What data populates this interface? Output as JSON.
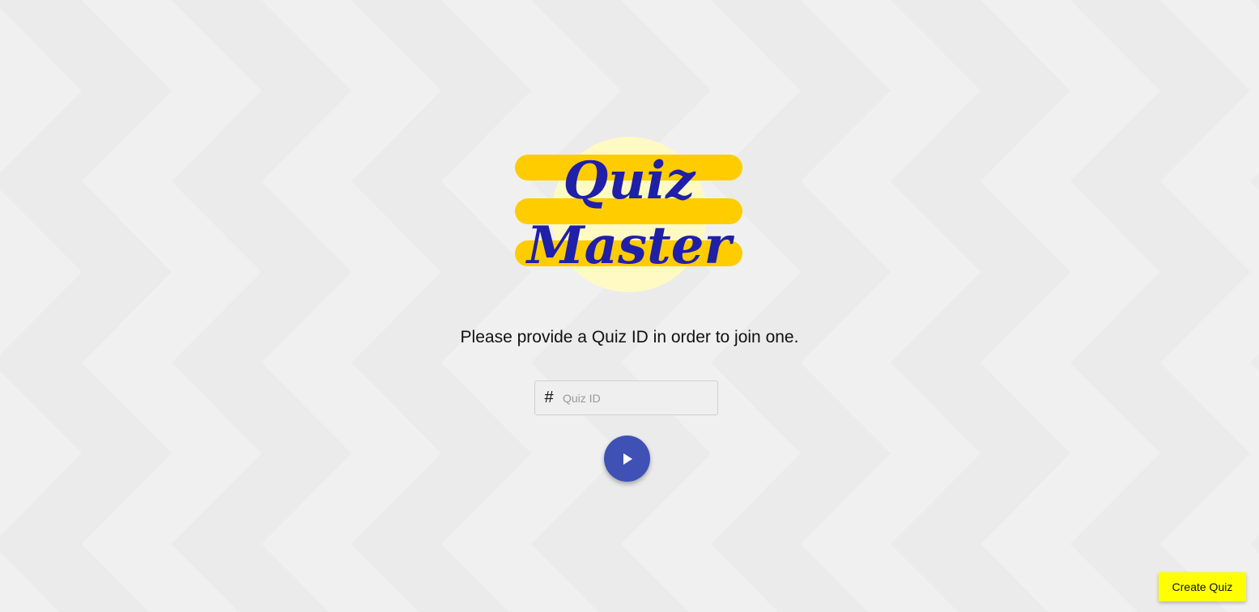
{
  "logo": {
    "line1": "Quiz",
    "line2": "Master"
  },
  "prompt_text": "Please provide a Quiz ID in order to join one.",
  "quiz_id_field": {
    "prefix": "#",
    "placeholder": "Quiz ID",
    "value": ""
  },
  "create_quiz_label": "Create Quiz",
  "colors": {
    "primary": "#3f51b5",
    "accent_yellow": "#ffff00",
    "logo_stripe": "#ffcc00",
    "logo_circle": "#fff9c4",
    "logo_text": "#1f1fa8",
    "background": "#eeeeee"
  },
  "icons": {
    "play_button": "play-icon"
  }
}
